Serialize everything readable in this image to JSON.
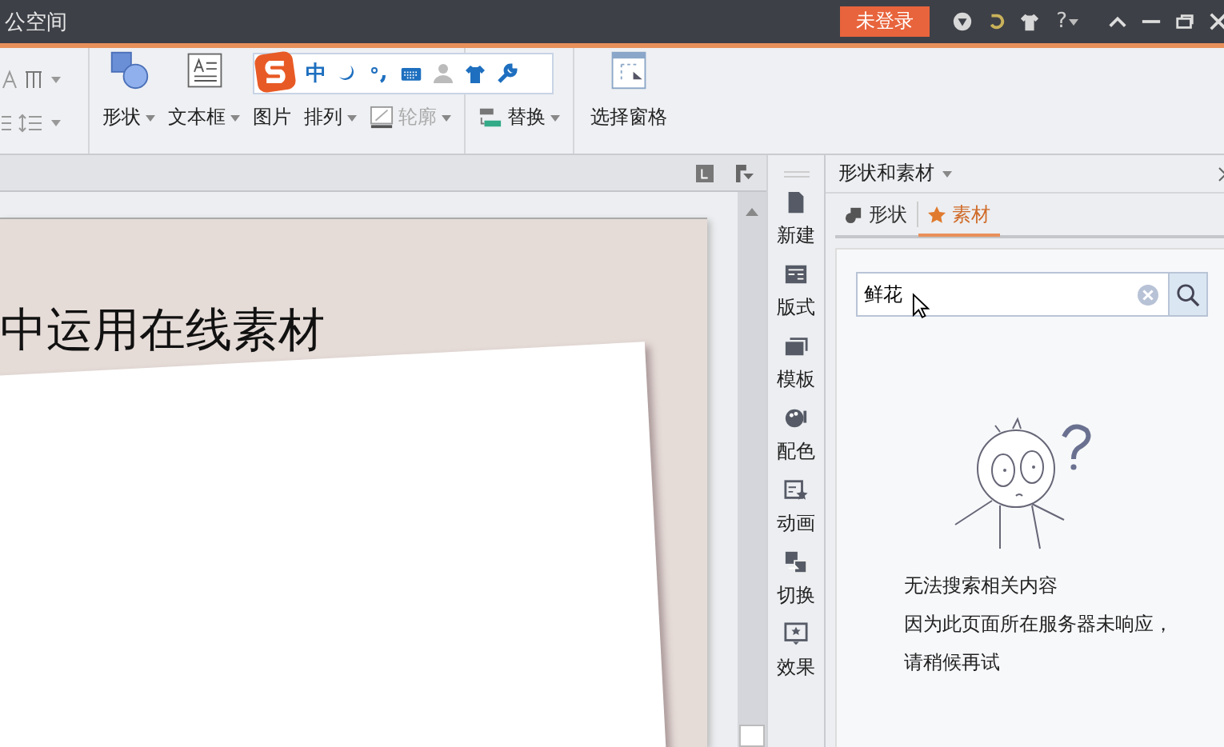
{
  "window": {
    "title": "公空间",
    "login_badge": "未登录",
    "help": "?"
  },
  "ribbon": {
    "small_tools": [
      {
        "dropdown": true
      },
      {
        "dropdown": true
      }
    ],
    "buttons": [
      {
        "kind": "shapes",
        "label": "形状",
        "dropdown": true,
        "disabled": false
      },
      {
        "kind": "textbox",
        "label": "文本框",
        "dropdown": true,
        "disabled": false
      },
      {
        "kind": "picture",
        "label": "图片",
        "dropdown": false,
        "disabled": false
      },
      {
        "kind": "arrange",
        "label": "排列",
        "dropdown": true,
        "disabled": false
      },
      {
        "kind": "outline",
        "label": "轮廓",
        "dropdown": true,
        "disabled": true
      },
      {
        "kind": "replace",
        "label": "替换",
        "dropdown": true,
        "disabled": false
      },
      {
        "kind": "pane",
        "label": "选择窗格",
        "dropdown": false,
        "disabled": false
      }
    ]
  },
  "ime_toolbar": {
    "mode": "中"
  },
  "slide": {
    "title": "中运用在线素材"
  },
  "side_strip": [
    {
      "kind": "new",
      "label": "新建"
    },
    {
      "kind": "layout",
      "label": "版式"
    },
    {
      "kind": "template",
      "label": "模板"
    },
    {
      "kind": "color",
      "label": "配色"
    },
    {
      "kind": "animation",
      "label": "动画"
    },
    {
      "kind": "transition",
      "label": "切换"
    },
    {
      "kind": "effect",
      "label": "效果"
    }
  ],
  "panel": {
    "title": "形状和素材",
    "tabs": [
      {
        "kind": "shapes",
        "label": "形状",
        "selected": false
      },
      {
        "kind": "material",
        "label": "素材",
        "selected": true
      }
    ],
    "search": {
      "value": "鲜花"
    },
    "messages": [
      "无法搜索相关内容",
      "因为此页面所在服务器未响应，",
      "请稍候再试"
    ]
  }
}
